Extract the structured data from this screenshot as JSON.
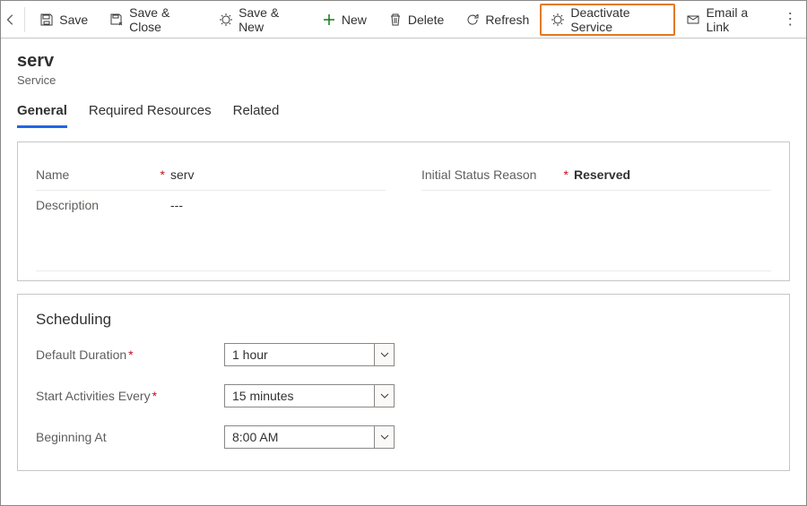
{
  "toolbar": {
    "save": "Save",
    "save_close": "Save & Close",
    "save_new": "Save & New",
    "new": "New",
    "delete": "Delete",
    "refresh": "Refresh",
    "deactivate": "Deactivate Service",
    "email_link": "Email a Link"
  },
  "header": {
    "title": "serv",
    "subtitle": "Service"
  },
  "tabs": {
    "general": "General",
    "required_resources": "Required Resources",
    "related": "Related"
  },
  "general": {
    "name_label": "Name",
    "name_value": "serv",
    "status_label": "Initial Status Reason",
    "status_value": "Reserved",
    "description_label": "Description",
    "description_value": "---"
  },
  "scheduling": {
    "title": "Scheduling",
    "default_duration_label": "Default Duration",
    "default_duration_value": "1 hour",
    "start_every_label": "Start Activities Every",
    "start_every_value": "15 minutes",
    "beginning_at_label": "Beginning At",
    "beginning_at_value": "8:00 AM"
  }
}
